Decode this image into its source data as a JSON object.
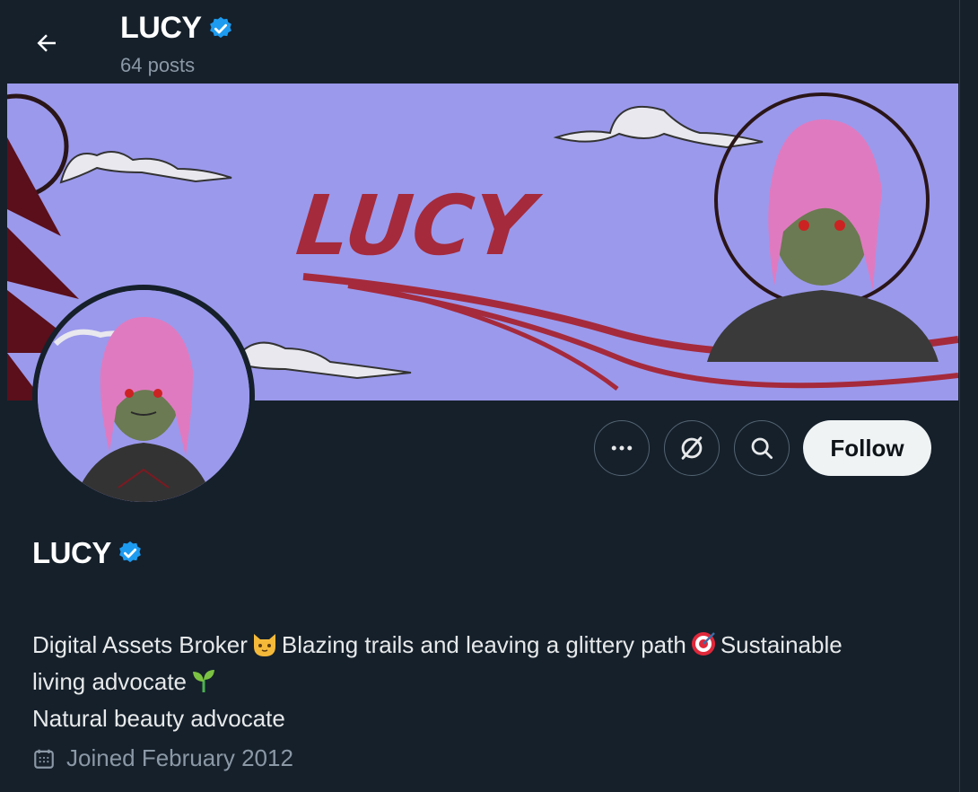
{
  "header": {
    "title": "LUCY",
    "posts": "64 posts",
    "back_icon": "arrow-left-icon",
    "verified_icon": "verified-badge-icon"
  },
  "banner": {
    "text": "LUCY",
    "background": "#9b99ec",
    "accent": "#a52a3b"
  },
  "actions": {
    "more_icon": "more-horizontal-icon",
    "noncustodial_icon": "circle-slash-icon",
    "search_icon": "search-icon",
    "follow_label": "Follow"
  },
  "profile": {
    "name": "LUCY",
    "bio_line1_a": "Digital Assets Broker",
    "bio_line1_b": "Blazing trails and leaving a glittery path",
    "bio_line1_c": "Sustainable",
    "bio_line2": "living advocate",
    "bio_line3": "Natural beauty advocate",
    "bio_emojis": [
      "cat-face-emoji",
      "direct-hit-emoji",
      "seedling-emoji"
    ],
    "joined": "Joined February 2012",
    "joined_icon": "calendar-icon"
  },
  "colors": {
    "background": "#15202b",
    "verified": "#1d9bf0",
    "follow_bg": "#eff3f4",
    "muted_text": "#8b98a5"
  }
}
